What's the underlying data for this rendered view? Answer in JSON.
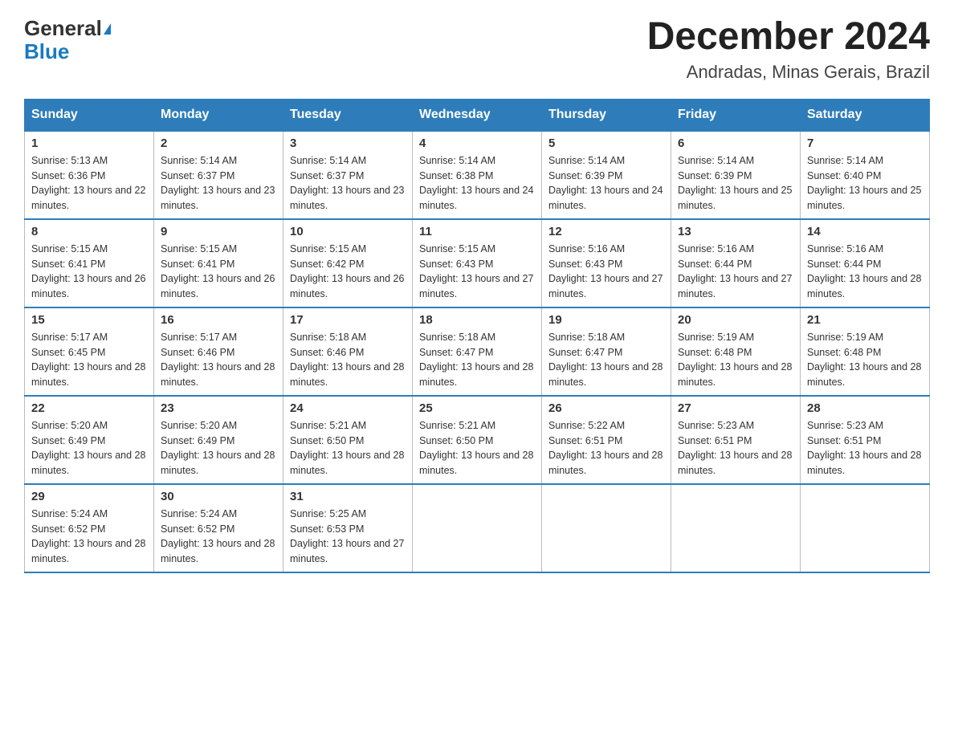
{
  "header": {
    "logo_line1": "General",
    "logo_line2": "Blue",
    "title": "December 2024",
    "subtitle": "Andradas, Minas Gerais, Brazil"
  },
  "days_of_week": [
    "Sunday",
    "Monday",
    "Tuesday",
    "Wednesday",
    "Thursday",
    "Friday",
    "Saturday"
  ],
  "weeks": [
    [
      {
        "day": "1",
        "sunrise": "5:13 AM",
        "sunset": "6:36 PM",
        "daylight": "13 hours and 22 minutes."
      },
      {
        "day": "2",
        "sunrise": "5:14 AM",
        "sunset": "6:37 PM",
        "daylight": "13 hours and 23 minutes."
      },
      {
        "day": "3",
        "sunrise": "5:14 AM",
        "sunset": "6:37 PM",
        "daylight": "13 hours and 23 minutes."
      },
      {
        "day": "4",
        "sunrise": "5:14 AM",
        "sunset": "6:38 PM",
        "daylight": "13 hours and 24 minutes."
      },
      {
        "day": "5",
        "sunrise": "5:14 AM",
        "sunset": "6:39 PM",
        "daylight": "13 hours and 24 minutes."
      },
      {
        "day": "6",
        "sunrise": "5:14 AM",
        "sunset": "6:39 PM",
        "daylight": "13 hours and 25 minutes."
      },
      {
        "day": "7",
        "sunrise": "5:14 AM",
        "sunset": "6:40 PM",
        "daylight": "13 hours and 25 minutes."
      }
    ],
    [
      {
        "day": "8",
        "sunrise": "5:15 AM",
        "sunset": "6:41 PM",
        "daylight": "13 hours and 26 minutes."
      },
      {
        "day": "9",
        "sunrise": "5:15 AM",
        "sunset": "6:41 PM",
        "daylight": "13 hours and 26 minutes."
      },
      {
        "day": "10",
        "sunrise": "5:15 AM",
        "sunset": "6:42 PM",
        "daylight": "13 hours and 26 minutes."
      },
      {
        "day": "11",
        "sunrise": "5:15 AM",
        "sunset": "6:43 PM",
        "daylight": "13 hours and 27 minutes."
      },
      {
        "day": "12",
        "sunrise": "5:16 AM",
        "sunset": "6:43 PM",
        "daylight": "13 hours and 27 minutes."
      },
      {
        "day": "13",
        "sunrise": "5:16 AM",
        "sunset": "6:44 PM",
        "daylight": "13 hours and 27 minutes."
      },
      {
        "day": "14",
        "sunrise": "5:16 AM",
        "sunset": "6:44 PM",
        "daylight": "13 hours and 28 minutes."
      }
    ],
    [
      {
        "day": "15",
        "sunrise": "5:17 AM",
        "sunset": "6:45 PM",
        "daylight": "13 hours and 28 minutes."
      },
      {
        "day": "16",
        "sunrise": "5:17 AM",
        "sunset": "6:46 PM",
        "daylight": "13 hours and 28 minutes."
      },
      {
        "day": "17",
        "sunrise": "5:18 AM",
        "sunset": "6:46 PM",
        "daylight": "13 hours and 28 minutes."
      },
      {
        "day": "18",
        "sunrise": "5:18 AM",
        "sunset": "6:47 PM",
        "daylight": "13 hours and 28 minutes."
      },
      {
        "day": "19",
        "sunrise": "5:18 AM",
        "sunset": "6:47 PM",
        "daylight": "13 hours and 28 minutes."
      },
      {
        "day": "20",
        "sunrise": "5:19 AM",
        "sunset": "6:48 PM",
        "daylight": "13 hours and 28 minutes."
      },
      {
        "day": "21",
        "sunrise": "5:19 AM",
        "sunset": "6:48 PM",
        "daylight": "13 hours and 28 minutes."
      }
    ],
    [
      {
        "day": "22",
        "sunrise": "5:20 AM",
        "sunset": "6:49 PM",
        "daylight": "13 hours and 28 minutes."
      },
      {
        "day": "23",
        "sunrise": "5:20 AM",
        "sunset": "6:49 PM",
        "daylight": "13 hours and 28 minutes."
      },
      {
        "day": "24",
        "sunrise": "5:21 AM",
        "sunset": "6:50 PM",
        "daylight": "13 hours and 28 minutes."
      },
      {
        "day": "25",
        "sunrise": "5:21 AM",
        "sunset": "6:50 PM",
        "daylight": "13 hours and 28 minutes."
      },
      {
        "day": "26",
        "sunrise": "5:22 AM",
        "sunset": "6:51 PM",
        "daylight": "13 hours and 28 minutes."
      },
      {
        "day": "27",
        "sunrise": "5:23 AM",
        "sunset": "6:51 PM",
        "daylight": "13 hours and 28 minutes."
      },
      {
        "day": "28",
        "sunrise": "5:23 AM",
        "sunset": "6:51 PM",
        "daylight": "13 hours and 28 minutes."
      }
    ],
    [
      {
        "day": "29",
        "sunrise": "5:24 AM",
        "sunset": "6:52 PM",
        "daylight": "13 hours and 28 minutes."
      },
      {
        "day": "30",
        "sunrise": "5:24 AM",
        "sunset": "6:52 PM",
        "daylight": "13 hours and 28 minutes."
      },
      {
        "day": "31",
        "sunrise": "5:25 AM",
        "sunset": "6:53 PM",
        "daylight": "13 hours and 27 minutes."
      },
      null,
      null,
      null,
      null
    ]
  ]
}
